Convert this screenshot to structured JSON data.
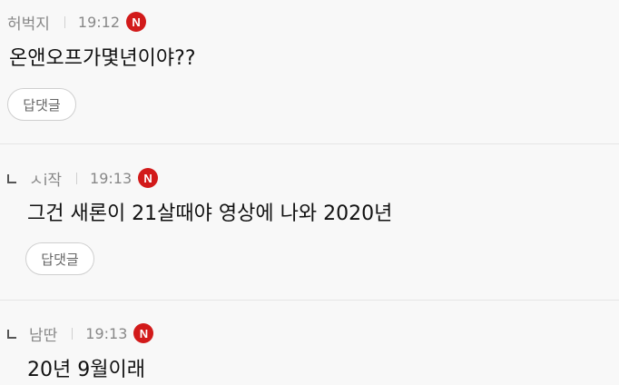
{
  "comments": [
    {
      "nickname": "허벅지",
      "time": "19:12",
      "badge": "N",
      "text": "온앤오프가몇년이야??",
      "reply_label": "답댓글",
      "is_reply": false
    },
    {
      "nickname": "ㅅi작",
      "time": "19:13",
      "badge": "N",
      "text": "그건 새론이 21살때야 영상에 나와 2020년",
      "reply_label": "답댓글",
      "is_reply": true
    },
    {
      "nickname": "남딴",
      "time": "19:13",
      "badge": "N",
      "text": "20년 9월이래",
      "is_reply": true
    }
  ],
  "colors": {
    "background": "#f8f8f8",
    "badge": "#d21a1a",
    "meta_text": "#888888",
    "divider": "#e6e6e6"
  },
  "icons": {
    "reply_indicator": "reply-arrow-icon",
    "new_badge": "new-badge-icon"
  }
}
